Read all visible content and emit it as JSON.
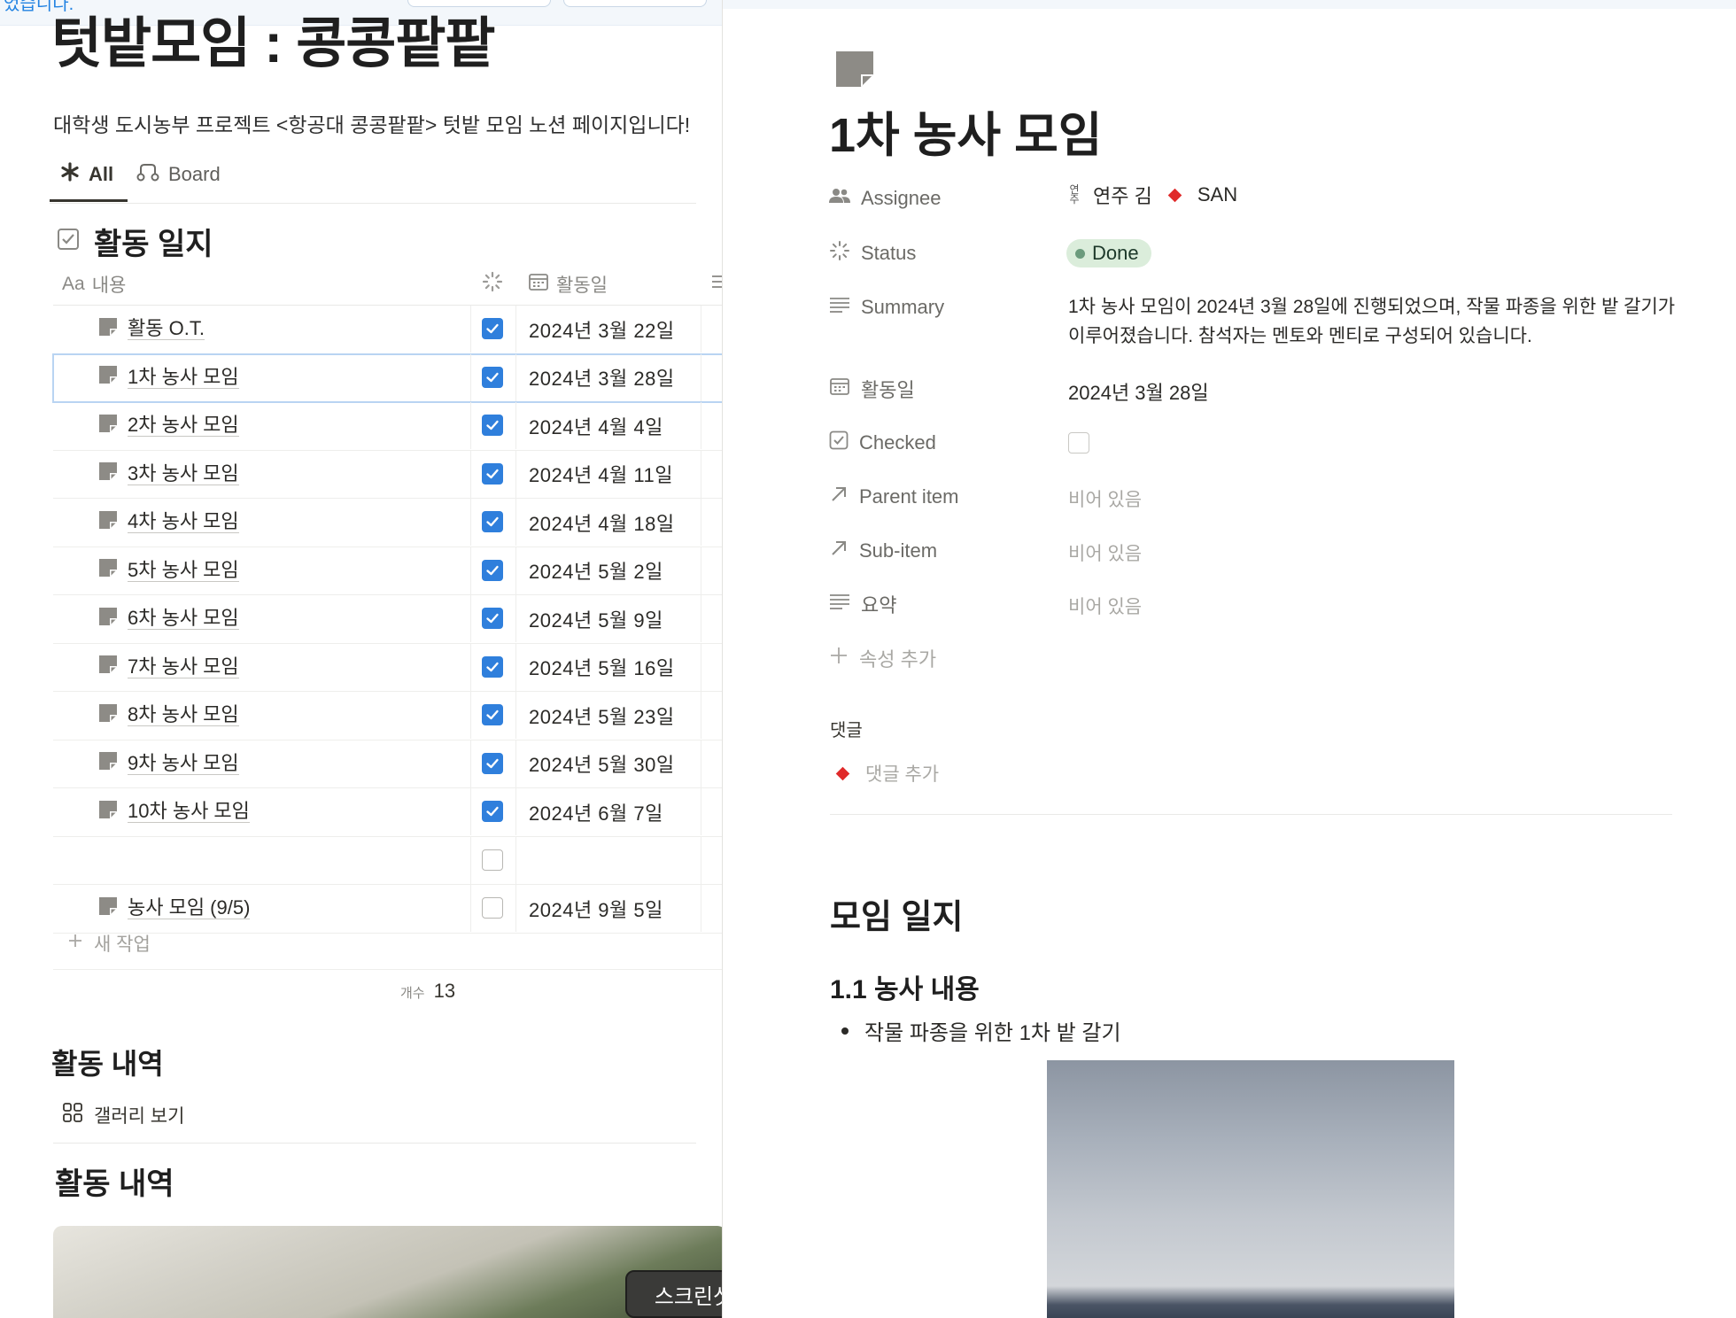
{
  "left": {
    "notice": "었습니다.",
    "page_title": "텃밭모임 : 콩콩팥팥",
    "description": "대학생 도시농부 프로젝트 <항공대 콩콩팥팥> 텃밭 모임 노션 페이지입니다!",
    "tabs": [
      {
        "label": "All",
        "icon": "asterisk-icon",
        "active": true
      },
      {
        "label": "Board",
        "icon": "board-icon",
        "active": false
      }
    ],
    "database_title": "활동 일지",
    "columns": {
      "title_prefix": "Aa",
      "title": "내용",
      "status_icon": "status-icon",
      "date": "활동일"
    },
    "rows": [
      {
        "title": "활동 O.T.",
        "checked": true,
        "date": "2024년 3월 22일"
      },
      {
        "title": "1차 농사 모임",
        "checked": true,
        "date": "2024년 3월 28일",
        "selected": true
      },
      {
        "title": "2차 농사 모임",
        "checked": true,
        "date": "2024년 4월 4일"
      },
      {
        "title": "3차 농사 모임",
        "checked": true,
        "date": "2024년 4월 11일"
      },
      {
        "title": "4차 농사 모임",
        "checked": true,
        "date": "2024년 4월 18일"
      },
      {
        "title": "5차 농사 모임",
        "checked": true,
        "date": "2024년 5월 2일"
      },
      {
        "title": "6차 농사 모임",
        "checked": true,
        "date": "2024년 5월 9일"
      },
      {
        "title": "7차 농사 모임",
        "checked": true,
        "date": "2024년 5월 16일"
      },
      {
        "title": "8차 농사 모임",
        "checked": true,
        "date": "2024년 5월 23일"
      },
      {
        "title": "9차 농사 모임",
        "checked": true,
        "date": "2024년 5월 30일"
      },
      {
        "title": "10차 농사 모임",
        "checked": true,
        "date": "2024년 6월 7일"
      },
      {
        "title": "",
        "checked": false,
        "date": ""
      },
      {
        "title": "농사 모임 (9/5)",
        "checked": false,
        "date": "2024년 9월 5일"
      }
    ],
    "new_task": "새 작업",
    "count_label": "개수",
    "count_value": "13",
    "section1_title": "활동 내역",
    "gallery_view": "갤러리 보기",
    "section2_title": "활동 내역",
    "capture_badge": "스크린샷"
  },
  "right": {
    "title": "1차 농사 모임",
    "properties": {
      "assignee": {
        "label": "Assignee",
        "avatar_text": "연주",
        "person1": "연주 김",
        "person2": "SAN"
      },
      "status": {
        "label": "Status",
        "value": "Done"
      },
      "summary": {
        "label": "Summary",
        "value": "1차 농사 모임이 2024년 3월 28일에 진행되었으며, 작물 파종을 위한 밭 갈기가 이루어졌습니다. 참석자는 멘토와 멘티로 구성되어 있습니다."
      },
      "date": {
        "label": "활동일",
        "value": "2024년 3월 28일"
      },
      "checked": {
        "label": "Checked",
        "value": false
      },
      "parent": {
        "label": "Parent item",
        "value": "비어 있음"
      },
      "sub": {
        "label": "Sub-item",
        "value": "비어 있음"
      },
      "summary_ko": {
        "label": "요약",
        "value": "비어 있음"
      },
      "add_property": "속성 추가"
    },
    "comments_label": "댓글",
    "add_comment": "댓글 추가",
    "heading_log": "모임 일지",
    "heading_farm": "1.1 농사 내용",
    "bullet": "작물 파종을 위한 1차 밭 갈기"
  },
  "colors": {
    "accent": "#2f7fdc",
    "done_bg": "#dbeddb",
    "done_dot": "#6c9b7d",
    "avatar_red": "#e02a2a"
  }
}
